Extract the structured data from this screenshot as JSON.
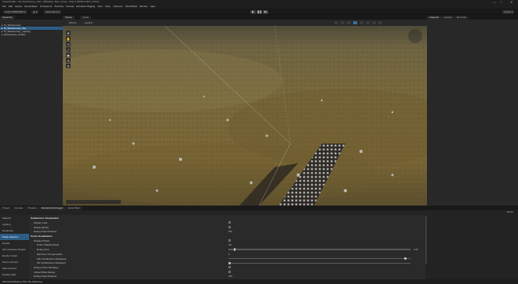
{
  "window": {
    "title": "ProjectFolder - 05_StartJourney_Wet - [Windows, Mac, Linux] - Unity 6 (6000.0.23f1) <DX11>",
    "controls": [
      "—",
      "□",
      "✕"
    ]
  },
  "menu": [
    "File",
    "Edit",
    "Assets",
    "GameObject",
    "Component",
    "Services",
    "Tutorial",
    "Animation Rigging",
    "Jobs",
    "Tools",
    "Cutscene",
    "TimeOfVoid",
    "Window",
    "Help"
  ],
  "toolbar": {
    "account_label": "Unity 6 PREVIEW ▾",
    "cloud_label": "☁ ▾",
    "asset_store_label": "Asset Store ▾",
    "play_icons": [
      "▶",
      "❚❚",
      "▶|"
    ],
    "layers_label": "Layout ▾"
  },
  "hierarchy": {
    "tab_label": "Hierarchy",
    "items": [
      {
        "label": "05_StartJourney",
        "selected": false
      },
      {
        "label": "05_StartJourney_Wet",
        "selected": true
      },
      {
        "label": "05_StartJourney_Lighting",
        "selected": false
      },
      {
        "label": "StartJourney_Scatter",
        "selected": false
      }
    ]
  },
  "scene": {
    "tabs": [
      "Scene",
      "Game"
    ],
    "active_tab": "Scene",
    "tools_labels": [
      "Pivot ▾",
      "Local ▾"
    ],
    "left_tools": [
      "✥",
      "✋",
      "⟲",
      "⤢",
      "▣",
      "⊕",
      "⚙"
    ]
  },
  "inspector": {
    "tabs": [
      "Inspector",
      "Lighting",
      "Recorder"
    ]
  },
  "bottom": {
    "tabs": [
      "Project",
      "Console",
      "Timeline",
      "Rendering Debugger",
      "Audio Mixer"
    ],
    "active_tab": "Rendering Debugger",
    "reset_label": "Reset",
    "categories": [
      {
        "label": "Material",
        "selected": false
      },
      {
        "label": "Lighting",
        "selected": false
      },
      {
        "label": "Rendering",
        "selected": false
      },
      {
        "label": "Probe Volumes",
        "selected": true
      },
      {
        "label": "Decals",
        "selected": false
      },
      {
        "label": "GPU Resident Drawer",
        "selected": false
      },
      {
        "label": "Render Graph",
        "selected": false
      },
      {
        "label": "Scene Camera",
        "selected": false
      },
      {
        "label": "Main Camera",
        "selected": false
      },
      {
        "label": "Display Stats",
        "selected": false
      }
    ],
    "properties": [
      {
        "label": "Subdivision Visualization",
        "type": "header",
        "indent": 0
      },
      {
        "label": "Display Cells",
        "type": "check",
        "indent": 1
      },
      {
        "label": "Display Bricks",
        "type": "check",
        "indent": 1
      },
      {
        "label": "Debug Draw Distance",
        "type": "value",
        "indent": 1,
        "value": "500"
      },
      {
        "label": "Probe Visualization",
        "type": "header",
        "indent": 0
      },
      {
        "label": "Display Probes",
        "type": "check",
        "indent": 1
      },
      {
        "label": "Probe Shading Mode",
        "type": "value",
        "indent": 2,
        "value": "SH"
      },
      {
        "label": "Debug Size",
        "type": "slider",
        "indent": 2,
        "value": "0.06",
        "fraction": 0.03
      },
      {
        "label": "Exposure Compensation",
        "type": "value",
        "indent": 2,
        "value": "0"
      },
      {
        "label": "Max Subdivisions Displayed",
        "type": "slider",
        "indent": 2,
        "value": "",
        "fraction": 0.98
      },
      {
        "label": "Min Subdivisions Displayed",
        "type": "slider",
        "indent": 2,
        "value": "",
        "fraction": 0.0
      },
      {
        "label": "Debug Probe Sampling",
        "type": "check",
        "indent": 1
      },
      {
        "label": "Virtual Offset Debug",
        "type": "check",
        "indent": 1
      },
      {
        "label": "Debug Draw Distance",
        "type": "value",
        "indent": 1,
        "value": "200"
      }
    ]
  },
  "status": {
    "text": "[Worldsoft] Baking ASG Tile Adjacency"
  },
  "colors": {
    "selection": "#2c5d87",
    "panel": "#282828",
    "background": "#191919"
  }
}
